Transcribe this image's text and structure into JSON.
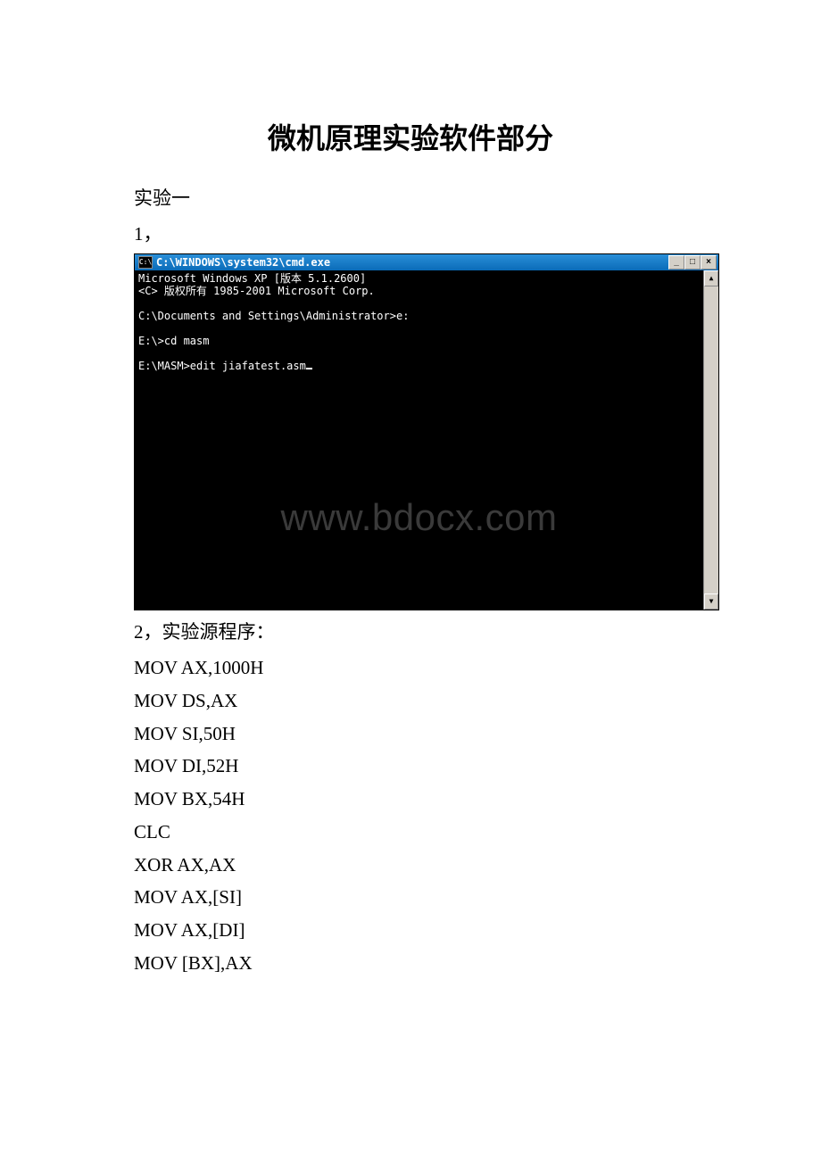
{
  "doc": {
    "title": "微机原理实验软件部分",
    "section1": "实验一",
    "item1": "1，",
    "item2": "2，实验源程序："
  },
  "cmd": {
    "icon_text": "C:\\",
    "title": "C:\\WINDOWS\\system32\\cmd.exe",
    "btn_min": "_",
    "btn_max": "□",
    "btn_close": "×",
    "scroll_up": "▲",
    "scroll_down": "▼",
    "line1": "Microsoft Windows XP [版本 5.1.2600]",
    "line2": "<C> 版权所有 1985-2001 Microsoft Corp.",
    "line3": "",
    "line4": "C:\\Documents and Settings\\Administrator>e:",
    "line5": "",
    "line6": "E:\\>cd masm",
    "line7": "",
    "line8": "E:\\MASM>edit jiafatest.asm",
    "watermark": "www.bdocx.com"
  },
  "code": {
    "l1": "MOV AX,1000H",
    "l2": "MOV DS,AX",
    "l3": "MOV SI,50H",
    "l4": "MOV DI,52H",
    "l5": "MOV BX,54H",
    "l6": "CLC",
    "l7": "XOR AX,AX",
    "l8": "MOV AX,[SI]",
    "l9": "MOV AX,[DI]",
    "l10": "MOV [BX],AX"
  }
}
